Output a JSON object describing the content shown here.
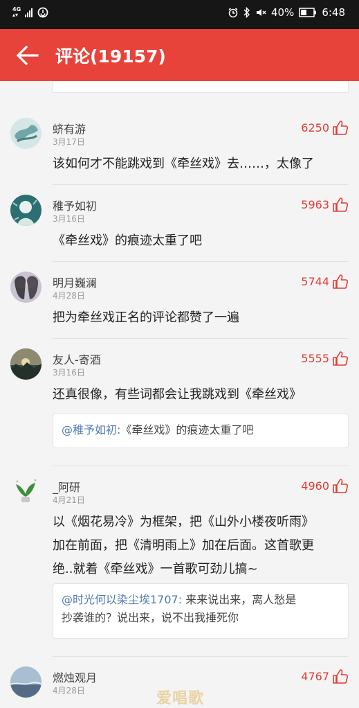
{
  "status_bar": {
    "signal": "4G",
    "battery": "40%",
    "time": "6:48"
  },
  "header": {
    "title": "评论(19157)"
  },
  "comments": [
    {
      "name": "蛴有游",
      "date": "3月17日",
      "likes": "6250",
      "lines": [
        "该如何才不能跳戏到《牵丝戏》去……，太像了"
      ]
    },
    {
      "name": "稚予如初",
      "date": "3月16日",
      "likes": "5963",
      "lines": [
        "《牵丝戏》的痕迹太重了吧"
      ]
    },
    {
      "name": "明月巍澜",
      "date": "4月28日",
      "likes": "5744",
      "lines": [
        "把为牵丝戏正名的评论都赞了一遍"
      ]
    },
    {
      "name": "友人-寄酒",
      "date": "3月16日",
      "likes": "5555",
      "lines": [
        "还真很像，有些词都会让我跳戏到《牵丝戏》"
      ],
      "reply": {
        "user": "@稚予如初:",
        "lines": [
          "《牵丝戏》的痕迹太重了吧"
        ]
      }
    },
    {
      "name": "_阿研",
      "date": "4月21日",
      "likes": "4960",
      "lines": [
        "以《烟花易冷》为框架，把《山外小楼夜听雨》",
        "加在前面，把《清明雨上》加在后面。这首歌更",
        "绝..就着《牵丝戏》一首歌可劲儿搞~"
      ],
      "reply": {
        "user": "@时光何以染尘埃1707:",
        "lines": [
          " 来来说出来，离人愁是",
          "抄袭谁的？说出来，说不出我捶死你"
        ]
      }
    },
    {
      "name": "燃烛观月",
      "date": "4月28日",
      "likes": "4767",
      "lines": []
    }
  ],
  "watermark": "爱唱歌",
  "colors": {
    "header_bg": "#e8433a",
    "like_red": "#e03c32",
    "reply_user_blue": "#4f79ad"
  }
}
